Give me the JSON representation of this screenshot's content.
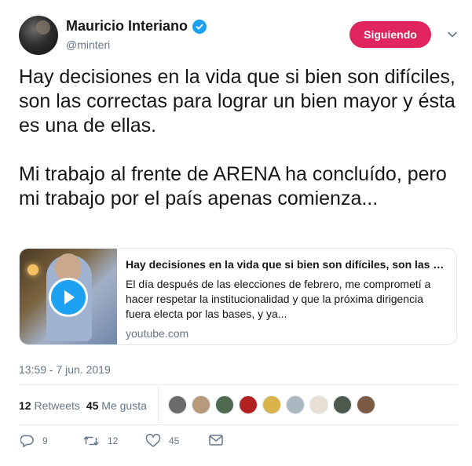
{
  "author": {
    "name": "Mauricio Interiano",
    "handle": "@minteri",
    "verified": true
  },
  "follow_button": {
    "label": "Siguiendo",
    "color": "#e0245e"
  },
  "tweet": {
    "text": "Hay decisiones en la vida que si bien son difíciles, son las correctas para lograr un bien mayor y ésta es una de ellas.\n\nMi trabajo al frente de ARENA ha concluído, pero mi trabajo por el país apenas comienza...",
    "timestamp": "13:59 - 7 jun. 2019"
  },
  "card": {
    "title": "Hay decisiones en la vida que si bien son difíciles, son las c...",
    "description": "El día después de las elecciones de febrero, me comprometí a hacer respetar la institucionalidad y que la próxima dirigencia fuera electa por las bases, y ya...",
    "domain": "youtube.com",
    "play_color": "#1da1f2"
  },
  "stats": {
    "retweets_count": "12",
    "retweets_label": "Retweets",
    "likes_count": "45",
    "likes_label": "Me gusta"
  },
  "likers": [
    {
      "color": "#6b6b6b"
    },
    {
      "color": "#b79a7c"
    },
    {
      "color": "#4f6a4f"
    },
    {
      "color": "#b22222"
    },
    {
      "color": "#d9b34a"
    },
    {
      "color": "#aab8c2"
    },
    {
      "color": "#e8dfd2"
    },
    {
      "color": "#4d5a4d"
    },
    {
      "color": "#7a5c44"
    }
  ],
  "actions": {
    "reply_count": "9",
    "retweet_count": "12",
    "like_count": "45"
  }
}
